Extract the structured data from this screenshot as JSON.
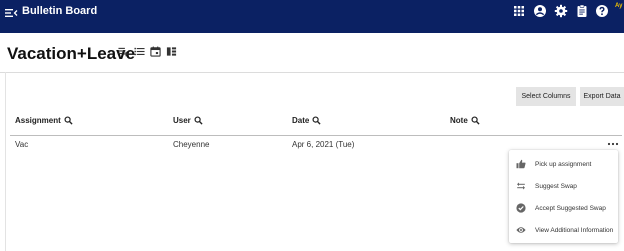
{
  "app": {
    "title": "Bulletin Board",
    "user_initials": "Ay"
  },
  "page": {
    "title": "Vacation+Leave"
  },
  "toolbar": {
    "select_columns": "Select Columns",
    "export_data": "Export Data"
  },
  "table": {
    "headers": [
      "Assignment",
      "User",
      "Date",
      "Note"
    ],
    "rows": [
      {
        "assignment": "Vac",
        "user": "Cheyenne",
        "date": "Apr 6, 2021 (Tue)",
        "note": ""
      }
    ]
  },
  "context_menu": {
    "items": [
      {
        "label": "Pick up assignment",
        "icon": "thumb-up-icon"
      },
      {
        "label": "Suggest Swap",
        "icon": "swap-icon"
      },
      {
        "label": "Accept Suggested Swap",
        "icon": "check-circle-icon"
      },
      {
        "label": "View Additional Information",
        "icon": "eye-icon"
      }
    ]
  },
  "colors": {
    "topbar": "#0b2163",
    "accent_initials": "#f2c200",
    "button_bg": "#e4e4e4"
  }
}
